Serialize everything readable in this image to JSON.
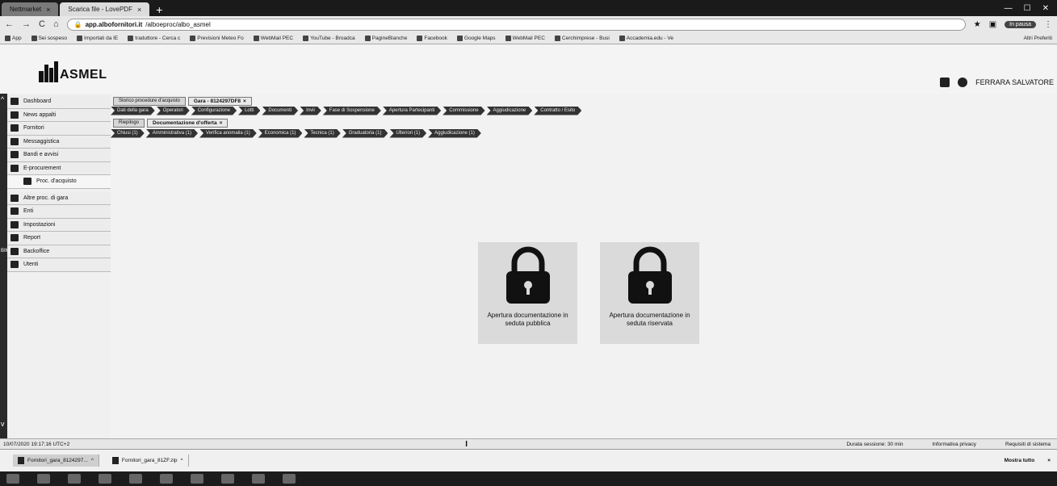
{
  "browser": {
    "tabs": [
      {
        "title": "Nettmarket"
      },
      {
        "title": "Scarica file - LovePDF"
      }
    ],
    "url_host": "app.albofornitori.it",
    "url_path": "/alboeproc/albo_asmel",
    "profile_label": "In pausa",
    "bookmarks": [
      "App",
      "Sei sospeso",
      "Importati da IE",
      "traduttore - Cerca c",
      "Previsioni Meteo Fo",
      "WebMail PEC",
      "YouTube - Broadca",
      "PagineBianche",
      "Facebook",
      "Google Maps",
      "WebMail PEC",
      "Cerchimprese - Busi",
      "Accademia.edu - Ve"
    ],
    "bookmarks_right": "Altri Preferiti"
  },
  "header": {
    "logo_text": "ASMEL",
    "user_name": "FERRARA SALVATORE"
  },
  "sidebar": {
    "vertical_label": "BIMIN",
    "items": [
      {
        "label": "Dashboard",
        "icon": "home-icon"
      },
      {
        "label": "News appalti",
        "icon": "news-icon"
      },
      {
        "label": "Fornitori",
        "icon": "truck-icon"
      },
      {
        "label": "Messaggistica",
        "icon": "message-icon"
      },
      {
        "label": "Bandi e avvisi",
        "icon": "megaphone-icon"
      },
      {
        "label": "E-procurement",
        "icon": "procurement-icon"
      },
      {
        "label": "Proc. d'acquisto",
        "icon": "list-icon",
        "sub": true
      },
      {
        "label": "Altre proc. di gara",
        "icon": "gavel-icon",
        "gap": true
      },
      {
        "label": "Enti",
        "icon": "building-icon"
      },
      {
        "label": "Impostazioni",
        "icon": "gear-icon"
      },
      {
        "label": "Report",
        "icon": "report-icon"
      },
      {
        "label": "Backoffice",
        "icon": "backoffice-icon"
      },
      {
        "label": "Utenti",
        "icon": "users-icon"
      }
    ]
  },
  "tabs_row": {
    "tabs": [
      {
        "label": "Storico procedure d'acquisto",
        "active": false
      },
      {
        "label": "Gara - 8124297DF8",
        "active": true
      }
    ]
  },
  "steps_row": [
    "Dati della gara",
    "Operatori",
    "Configurazione",
    "Lotti",
    "Documenti",
    "Invii",
    "Fase di Sospensione",
    "Apertura Partecipanti",
    "Commissione",
    "Aggiudicazione",
    "Contratto / Esito"
  ],
  "subtabs_row": {
    "tabs": [
      {
        "label": "Riepilogo",
        "active": false
      },
      {
        "label": "Documentazione d'offerta",
        "active": true
      }
    ]
  },
  "substeps_row": [
    "Chiusi (1)",
    "Amministrativa (1)",
    "Verifica anomalia (1)",
    "Economica (1)",
    "Tecnica (1)",
    "Graduatoria (1)",
    "Ulteriori (1)",
    "Aggiudicazione (1)"
  ],
  "lock_tiles": [
    {
      "label": "Apertura documentazione in seduta pubblica"
    },
    {
      "label": "Apertura documentazione in seduta riservata"
    }
  ],
  "status_bar": {
    "timestamp": "10/07/2020 19:17:16 UTC+2",
    "session": "Durata sessione: 30 min",
    "privacy": "Informativa privacy",
    "requirements": "Requisiti di sistema"
  },
  "downloads": {
    "items": [
      "Fornitori_gara_8124297...",
      "Fornitori_gara_81ZF.zip"
    ],
    "show_all": "Mostra tutto"
  },
  "colors": {
    "pill_bg": "#333333",
    "sidebar_strip": "#2a2a2a",
    "tile_bg": "#dadada"
  }
}
